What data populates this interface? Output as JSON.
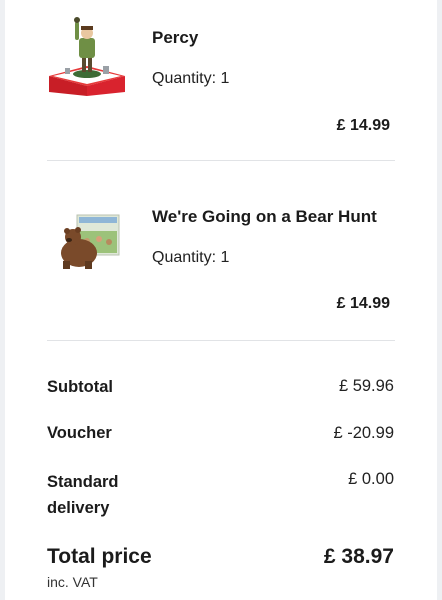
{
  "items": [
    {
      "name": "Percy",
      "quantity": "Quantity: 1",
      "price": "£ 14.99",
      "image": "tonie-figure-on-red-box"
    },
    {
      "name": "We're Going on a Bear Hunt",
      "quantity": "Quantity: 1",
      "price": "£ 14.99",
      "image": "bear-figure-with-book"
    }
  ],
  "summary": {
    "subtotal_label": "Subtotal",
    "subtotal_value": "£ 59.96",
    "voucher_label": "Voucher",
    "voucher_value": "£ -20.99",
    "delivery_label": "Standard delivery",
    "delivery_value": "£ 0.00",
    "total_label": "Total price",
    "total_value": "£ 38.97",
    "vat_note": "inc. VAT"
  },
  "colors": {
    "accent_red": "#d9232e",
    "divider": "#e1e3e6",
    "background": "#eef0f3"
  }
}
